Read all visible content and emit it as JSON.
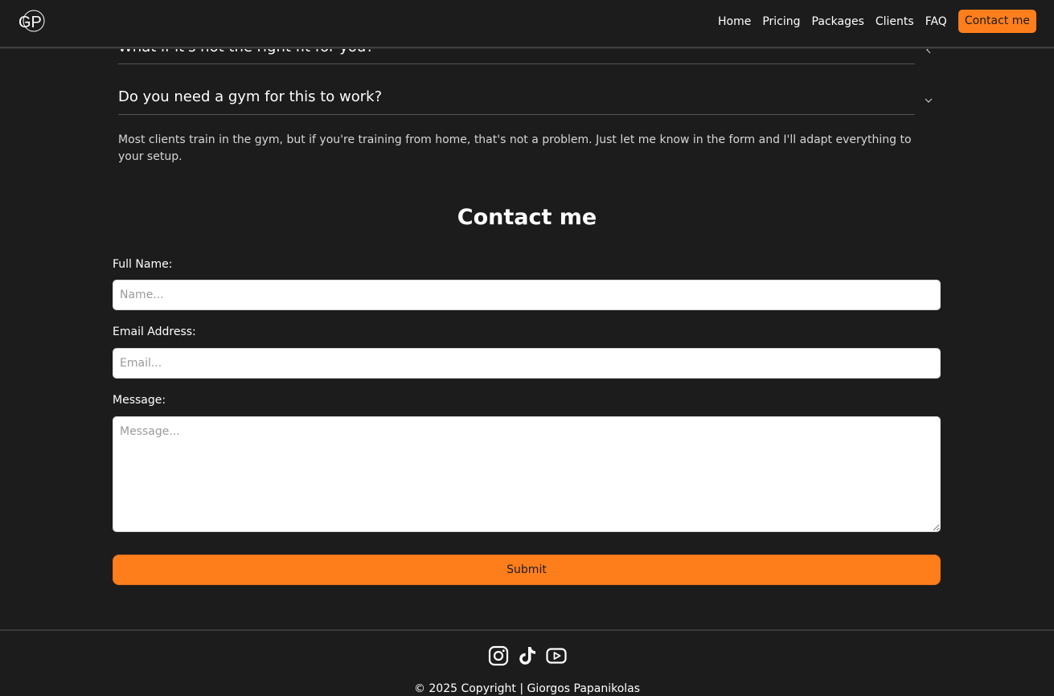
{
  "nav": {
    "logo_text": "GP",
    "links": [
      "Home",
      "Pricing",
      "Packages",
      "Clients",
      "FAQ"
    ],
    "cta": "Contact me",
    "accent": "#ff7e1c"
  },
  "faq": {
    "items": [
      {
        "question": "What if it's not the right fit for you?",
        "icon": "chevron-left-icon"
      },
      {
        "question": "Do you need a gym for this to work?",
        "icon": "chevron-down-icon"
      }
    ],
    "open_answer": "Most clients train in the gym, but if you're training from home, that's not a problem. Just let me know in the form and I'll adapt everything to your setup."
  },
  "contact": {
    "title": "Contact me",
    "name_label": "Full Name:",
    "name_placeholder": "Name...",
    "email_label": "Email Address:",
    "email_placeholder": "Email...",
    "message_label": "Message:",
    "message_placeholder": "Message...",
    "submit": "Submit"
  },
  "footer": {
    "socials": [
      "instagram-icon",
      "tiktok-icon",
      "youtube-icon"
    ],
    "copyright": "© 2025 Copyright | Giorgos Papanikolas"
  }
}
